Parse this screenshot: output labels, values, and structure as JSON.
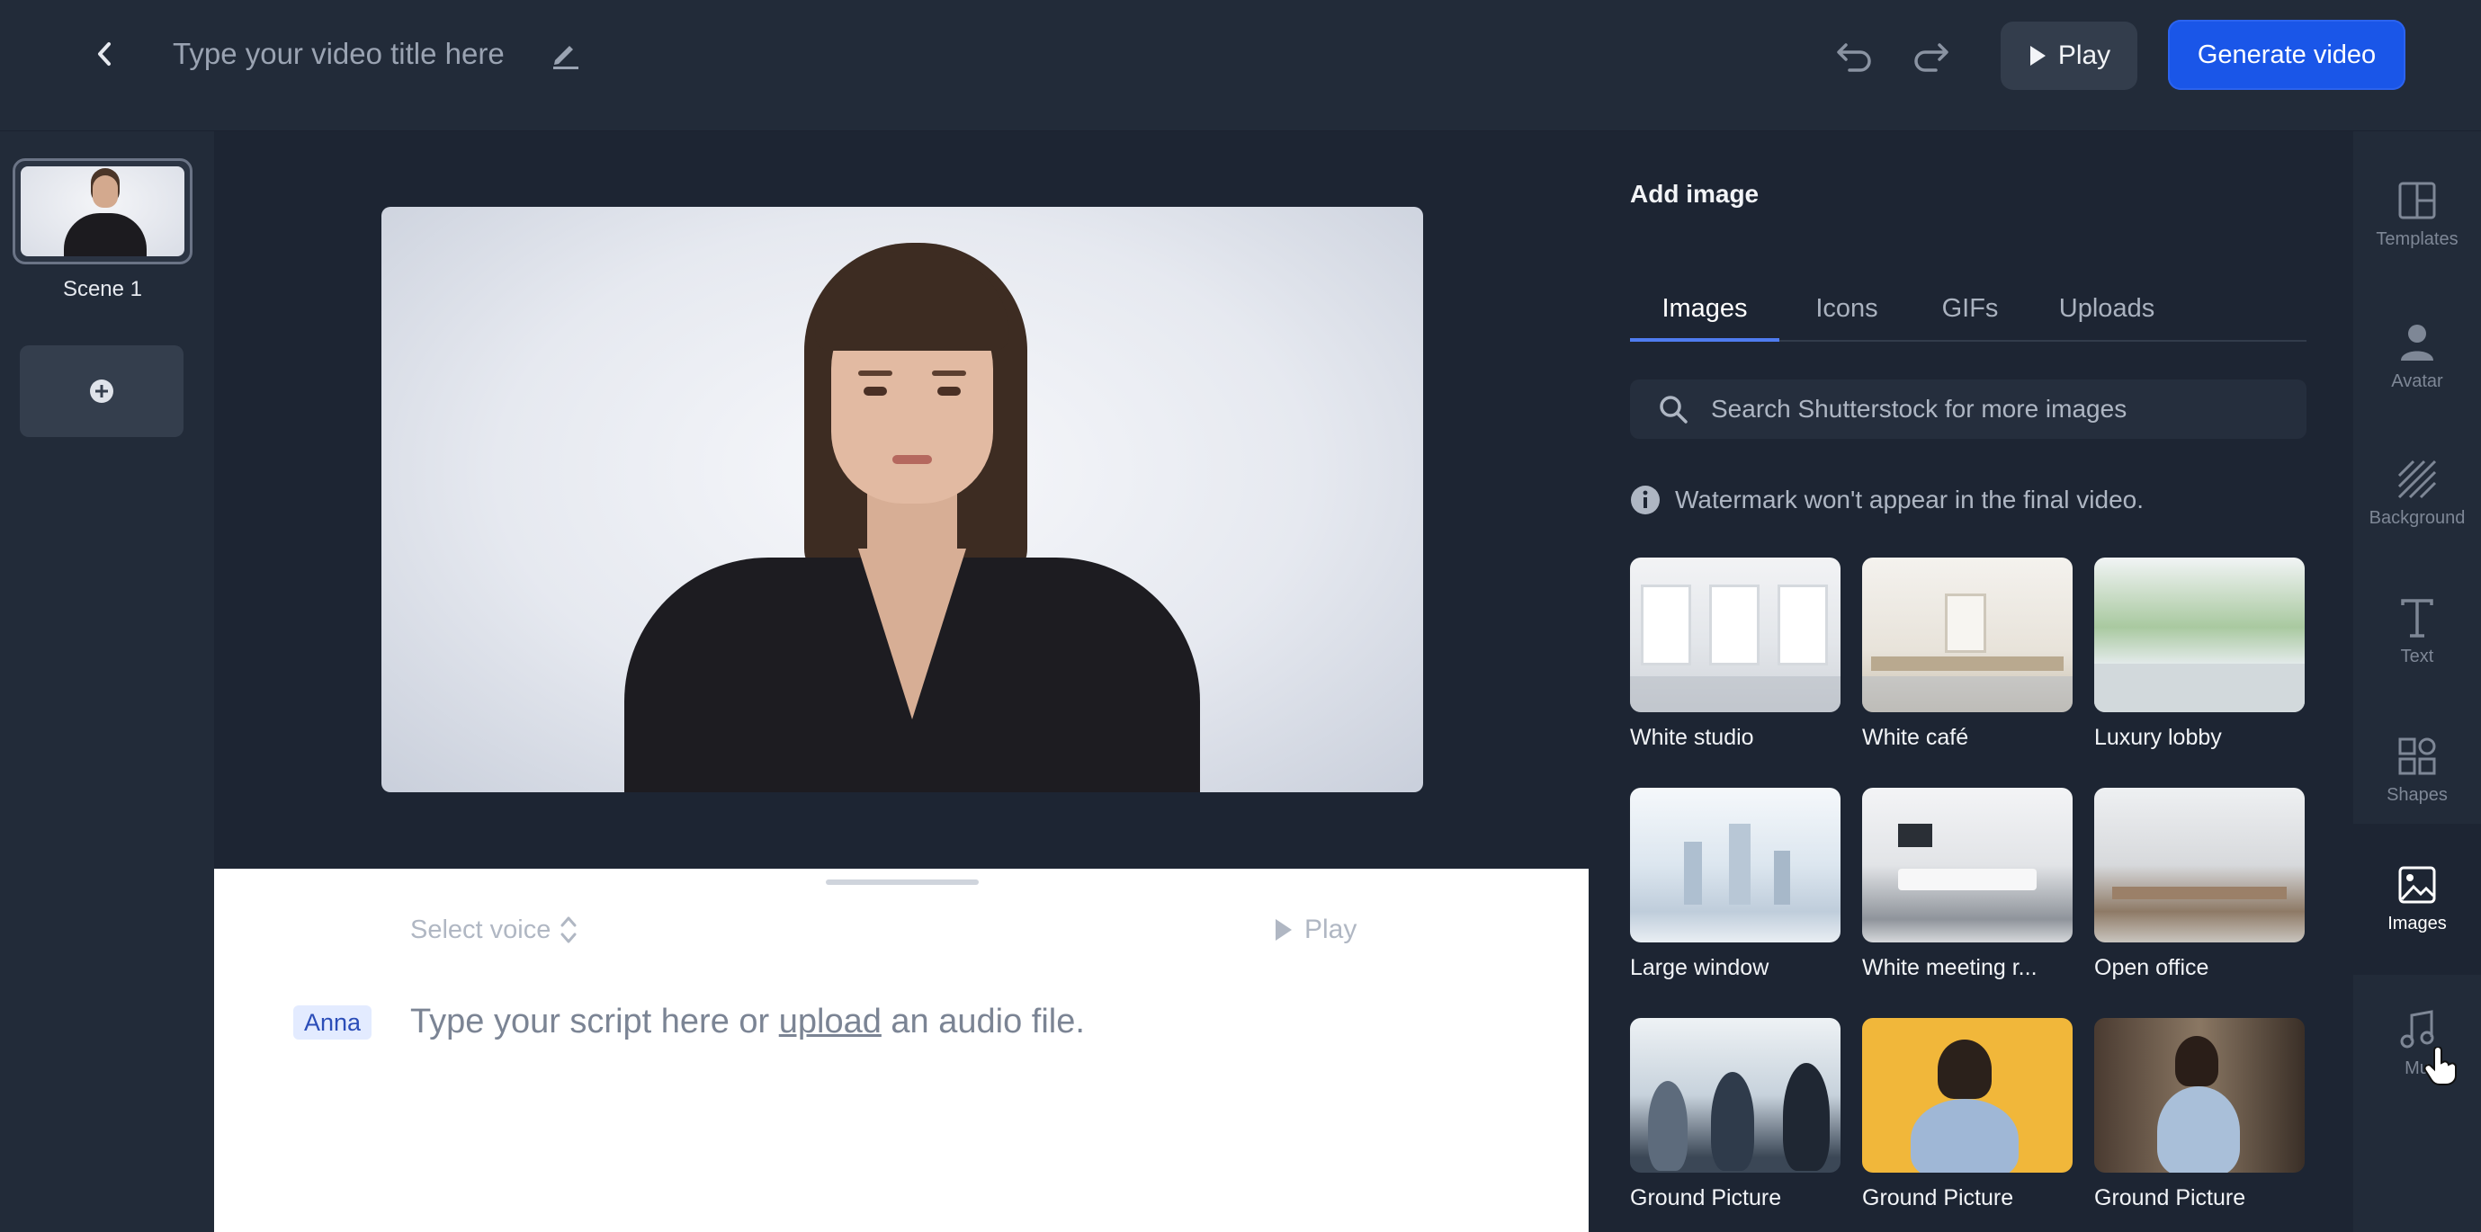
{
  "header": {
    "title_placeholder": "Type your video title here",
    "play_label": "Play",
    "generate_label": "Generate video"
  },
  "scenes": {
    "items": [
      {
        "label": "Scene 1"
      }
    ]
  },
  "script": {
    "select_voice_label": "Select voice",
    "play_label": "Play",
    "speaker": "Anna",
    "placeholder_before": "Type your script here or ",
    "upload_link": "upload",
    "placeholder_after": " an audio file."
  },
  "panel": {
    "title": "Add image",
    "tabs": [
      {
        "label": "Images",
        "active": true
      },
      {
        "label": "Icons",
        "active": false
      },
      {
        "label": "GIFs",
        "active": false
      },
      {
        "label": "Uploads",
        "active": false
      }
    ],
    "search_placeholder": "Search Shutterstock for more images",
    "notice": "Watermark won't appear in the final video.",
    "images": [
      {
        "label": "White studio"
      },
      {
        "label": "White café"
      },
      {
        "label": "Luxury lobby"
      },
      {
        "label": "Large window"
      },
      {
        "label": "White meeting r..."
      },
      {
        "label": "Open office"
      },
      {
        "label": "Ground Picture"
      },
      {
        "label": "Ground Picture"
      },
      {
        "label": "Ground Picture"
      }
    ]
  },
  "rail": {
    "items": [
      {
        "label": "Templates",
        "icon": "layout-icon"
      },
      {
        "label": "Avatar",
        "icon": "person-icon"
      },
      {
        "label": "Background",
        "icon": "hatch-icon"
      },
      {
        "label": "Text",
        "icon": "text-icon"
      },
      {
        "label": "Shapes",
        "icon": "shapes-icon"
      },
      {
        "label": "Images",
        "icon": "image-icon",
        "active": true
      },
      {
        "label": "Mu",
        "icon": "music-icon"
      }
    ]
  },
  "colors": {
    "accent": "#1a56e8",
    "background": "#222b39",
    "canvas_bg": "#1d2533",
    "speaker_badge_bg": "#e3ebff"
  }
}
